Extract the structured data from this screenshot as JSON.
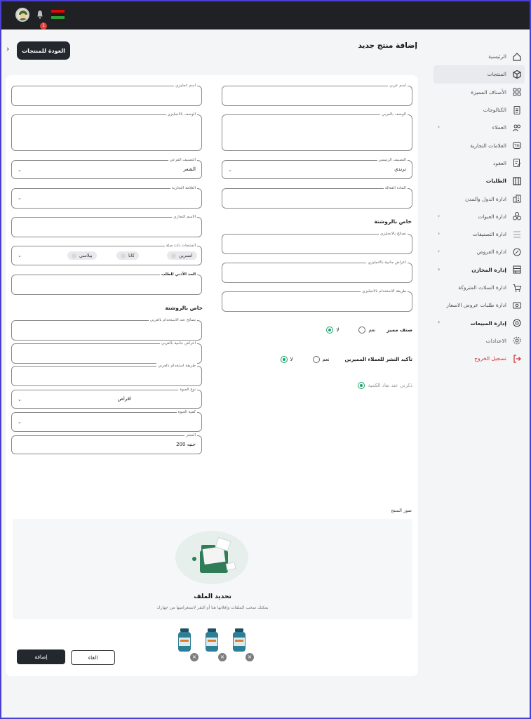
{
  "header": {
    "notification_count": "1",
    "flag_colors": [
      "#e10600",
      "#1a1a1a",
      "#2e9d3a"
    ]
  },
  "page": {
    "title": "إضافة منتج جديد",
    "back_label": "العودة للمنتجات"
  },
  "sidebar": {
    "items": [
      {
        "label": "الرئيسية",
        "icon": "home-icon"
      },
      {
        "label": "المنتجات",
        "icon": "box-icon",
        "active": true
      },
      {
        "label": "الأصناف المميزة",
        "icon": "grid-icon"
      },
      {
        "label": "الكتالوجات",
        "icon": "catalog-icon"
      },
      {
        "label": "العملاء",
        "icon": "users-icon",
        "chevron": true
      },
      {
        "label": "العلامات التجارية",
        "icon": "trademark-icon"
      },
      {
        "label": "العقود",
        "icon": "contract-icon"
      },
      {
        "label": "الطلبات",
        "icon": "orders-icon",
        "bold": true
      },
      {
        "label": "ادارة الدول والمدن",
        "icon": "city-icon"
      },
      {
        "label": "ادارة العبوات",
        "icon": "package-icon",
        "chevron": true
      },
      {
        "label": "ادارة التصنيفات",
        "icon": "category-icon",
        "chevron": true
      },
      {
        "label": "ادارة العروض",
        "icon": "offer-icon",
        "chevron": true
      },
      {
        "label": "إدارة المخازن",
        "icon": "warehouse-icon",
        "chevron": true,
        "bold": true
      },
      {
        "label": "ادارة السلات المتروكة",
        "icon": "cart-icon"
      },
      {
        "label": "ادارة طلبات عروض الاسعار",
        "icon": "quote-icon"
      },
      {
        "label": "إدارة المبيعات",
        "icon": "sales-icon",
        "chevron": true,
        "bold": true
      },
      {
        "label": "الاعدادات",
        "icon": "gear-icon"
      },
      {
        "label": "تسجيل الخروج",
        "icon": "logout-icon",
        "logout": true
      }
    ]
  },
  "form": {
    "name_ar": {
      "label": "اسم عربي",
      "value": ""
    },
    "name_en": {
      "label": "اسم انجليزي",
      "value": ""
    },
    "desc_ar": {
      "label": "الوصف بالعربي",
      "value": ""
    },
    "desc_en": {
      "label": "الوصف بالانجليزي",
      "value": ""
    },
    "main_category": {
      "label": "التصنيف الرئيسي",
      "value": "ترندي"
    },
    "sub_category": {
      "label": "التصنيف الفرعي",
      "value": "الشعر"
    },
    "active_ingredient": {
      "label": "المادة الفعالة",
      "value": ""
    },
    "brand": {
      "label": "العلامة التجارية",
      "value": ""
    },
    "trade_name": {
      "label": "الاسم التجاري",
      "value": ""
    },
    "related_products": {
      "label": "المنتجات ذات صلة",
      "chips": [
        "استرين",
        "كانا",
        "بيلاسي"
      ]
    },
    "min_order": {
      "label": "الحد الأدني للطلب",
      "value": ""
    },
    "prescription_title_right": "خاص بالروشتة",
    "prescription_title_left": "خاص بالروشتة",
    "advice_en": {
      "label": "نصائح بالانجليزي",
      "value": ""
    },
    "side_effects_en": {
      "label": "اعراض جانبية بالانجليزي",
      "value": ""
    },
    "usage_en": {
      "label": "طريقة الاستخدام بالانجليزي",
      "value": ""
    },
    "advice_ar": {
      "label": "نصائح عند الاستخدام بالعربي",
      "value": ""
    },
    "side_effects_ar": {
      "label": "اعراض جانبية بالعربي",
      "value": ""
    },
    "usage_ar": {
      "label": "طريقة استخدام بالعربي",
      "value": ""
    },
    "package_type": {
      "label": "نوع العبوة",
      "value": "اقراص"
    },
    "package_qty": {
      "label": "كمية العبوة",
      "value": ""
    },
    "price": {
      "label": "السعر",
      "value": "200 جنيه"
    },
    "featured": {
      "label": "صنف مميز",
      "yes": "نعم",
      "no": "لا",
      "selected": "no"
    },
    "confirm_featured": {
      "label": "تأكيد النشر للعملاء المميزين",
      "yes": "نعم",
      "no": "لا",
      "selected": "no"
    },
    "remind_out_of_stock": {
      "label": "ذكرني عند نفاد الكمية"
    }
  },
  "images": {
    "label": "صور المنتج",
    "upload_title": "تحديد الملف",
    "upload_sub": "يمكنك سحب الملفات وإفلاتها هنا أو النقر لاستعراضها من جهازك"
  },
  "actions": {
    "add": "إضافة",
    "cancel": "الغاء"
  }
}
